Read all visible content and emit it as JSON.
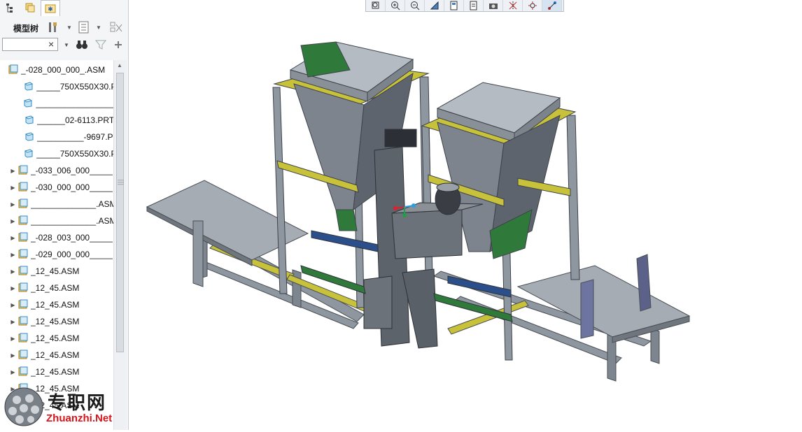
{
  "nav_tabs": [
    {
      "name": "model-tree-tab-icon",
      "active": false
    },
    {
      "name": "folder-browser-tab-icon",
      "active": false
    },
    {
      "name": "favorites-tab-icon",
      "active": true
    }
  ],
  "tree_toolbar": {
    "label": "模型树"
  },
  "search": {
    "value": "",
    "clear_glyph": "×"
  },
  "tree": {
    "root": {
      "label": "_-028_000_000_.ASM",
      "icon": "assembly-icon"
    },
    "items": [
      {
        "label": "_____750X550X30.PI",
        "icon": "part-icon",
        "expandable": false
      },
      {
        "label": "____________________",
        "icon": "part-icon",
        "expandable": false
      },
      {
        "label": "______02-6113.PRT",
        "icon": "part-icon",
        "expandable": false
      },
      {
        "label": "__________-9697.PI",
        "icon": "part-icon",
        "expandable": false
      },
      {
        "label": "_____750X550X30.PI",
        "icon": "part-icon",
        "expandable": false
      },
      {
        "label": "_-033_006_000_____",
        "icon": "assembly-icon",
        "expandable": true
      },
      {
        "label": "_-030_000_000_____",
        "icon": "assembly-icon",
        "expandable": true
      },
      {
        "label": "______________.ASM",
        "icon": "assembly-icon",
        "expandable": true
      },
      {
        "label": "______________.ASM",
        "icon": "assembly-icon",
        "expandable": true
      },
      {
        "label": "_-028_003_000_____",
        "icon": "assembly-icon",
        "expandable": true
      },
      {
        "label": "_-029_000_000_____",
        "icon": "assembly-icon",
        "expandable": true
      },
      {
        "label": "_12_45.ASM",
        "icon": "assembly-icon",
        "expandable": true
      },
      {
        "label": "_12_45.ASM",
        "icon": "assembly-icon",
        "expandable": true
      },
      {
        "label": "_12_45.ASM",
        "icon": "assembly-icon",
        "expandable": true
      },
      {
        "label": "_12_45.ASM",
        "icon": "assembly-icon",
        "expandable": true
      },
      {
        "label": "_12_45.ASM",
        "icon": "assembly-icon",
        "expandable": true
      },
      {
        "label": "_12_45.ASM",
        "icon": "assembly-icon",
        "expandable": true
      },
      {
        "label": "_12_45.ASM",
        "icon": "assembly-icon",
        "expandable": true
      },
      {
        "label": "_12_45.ASM",
        "icon": "assembly-icon",
        "expandable": true
      },
      {
        "label": "_12_45.ASM",
        "icon": "assembly-icon",
        "expandable": true
      }
    ]
  },
  "view_toolbar": [
    {
      "name": "refit-icon"
    },
    {
      "name": "zoom-in-icon"
    },
    {
      "name": "zoom-out-icon"
    },
    {
      "name": "repaint-icon"
    },
    {
      "name": "saved-orientations-icon"
    },
    {
      "name": "named-views-icon"
    },
    {
      "name": "display-style-icon"
    },
    {
      "name": "datum-display-icon"
    },
    {
      "name": "spin-center-icon"
    },
    {
      "name": "annotation-display-icon",
      "active": true
    }
  ],
  "watermark": {
    "text": "专职网",
    "url": "Zhuanzhi.Net"
  },
  "colors": {
    "panel": "#f4f5f7",
    "frame": "#8e96a0",
    "hopper": "#9aa0a8",
    "green": "#2f7a3a",
    "yellow": "#c8c23a"
  }
}
